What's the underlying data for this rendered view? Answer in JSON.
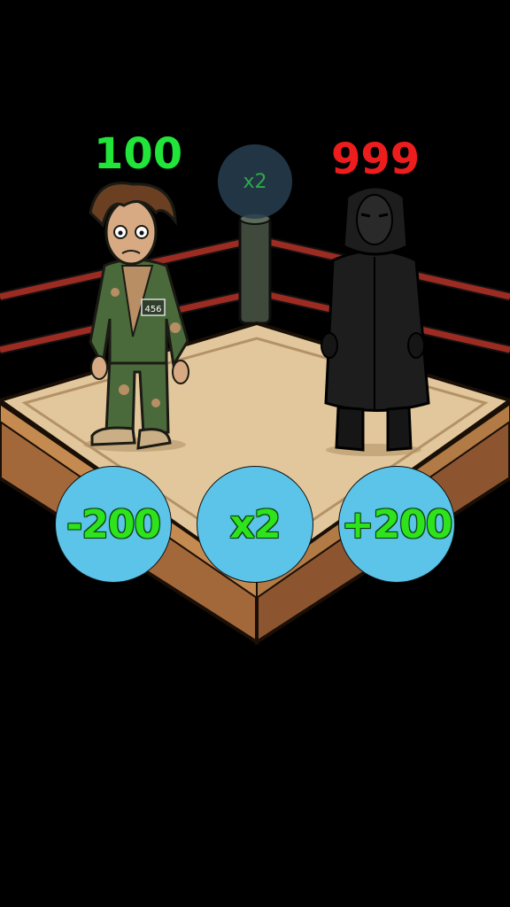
{
  "player": {
    "score": "100",
    "score_color": "#22e53a",
    "badge": "456"
  },
  "enemy": {
    "score": "999",
    "score_color": "#ee1d1d"
  },
  "pending_bubble": {
    "label": "x2",
    "text_color": "#2fa84a"
  },
  "choices": [
    {
      "label": "-200"
    },
    {
      "label": "x2"
    },
    {
      "label": "+200"
    }
  ],
  "colors": {
    "background": "#000000",
    "choice_fill": "#5bc4e8",
    "choice_text": "#2ee21c",
    "ring_mat": "#e2c79c",
    "ring_apron": "#a3683a",
    "ropes": "#9c2b22"
  }
}
